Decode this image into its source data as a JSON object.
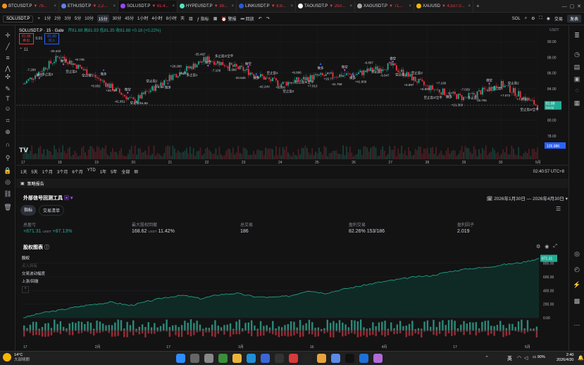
{
  "tabs": [
    {
      "symbol": "BTCUSDT.P",
      "change": "▼ 79...",
      "color": "#f7931a"
    },
    {
      "symbol": "ETHUSDT.P",
      "change": "▼ 2,2...",
      "color": "#627eea"
    },
    {
      "symbol": "SOLUSDT.P",
      "change": "▼ 81.4...",
      "color": "#9945ff"
    },
    {
      "symbol": "HYPEUSDT.P",
      "change": "▼ 39...",
      "color": "#50e3c2"
    },
    {
      "symbol": "LINKUSDT.P",
      "change": "▼ 8.9...",
      "color": "#2a5ada"
    },
    {
      "symbol": "TAOUSDT.P",
      "change": "▼ 250...",
      "color": "#ffffff"
    },
    {
      "symbol": "XAGUSDT.P",
      "change": "▼ 71...",
      "color": "#aaaaaa"
    },
    {
      "symbol": "XAUUSD",
      "change": "▼ 4,527.0...",
      "color": "#f5b800"
    }
  ],
  "toolbar": {
    "symbol": "SOLUSDT.P",
    "intervals": [
      "1分",
      "2分",
      "3分",
      "5分",
      "10分",
      "15分",
      "30分",
      "45分",
      "1小时",
      "4小时",
      "8小时",
      "天"
    ],
    "selected_interval": "15分",
    "indicators": "指标",
    "alert": "警报",
    "replay": "回放",
    "sol_label": "SOL",
    "trade": "交易",
    "publish": "发表"
  },
  "legend": {
    "title": "SOLUSDT.P · 15 · Gate",
    "ohlc": "开81.69 高81.93 低81.35 收81.88 +0.18 (+0.22%)",
    "sell_price": "81.88",
    "sell_label": "卖出",
    "spread": "0.01",
    "buy_price": "81.89",
    "buy_label": "买入",
    "indicator_count": "11"
  },
  "price_axis": {
    "currency": "USDT",
    "ticks": [
      "90.00",
      "88.00",
      "86.00",
      "84.00",
      "82.00",
      "80.00",
      "78.00"
    ],
    "last_price": "81.88",
    "countdown": "04:02",
    "equity_tag": "126.98K"
  },
  "chart_data": {
    "type": "line",
    "x": [
      "17",
      "18",
      "19",
      "20",
      "21",
      "22",
      "23",
      "24",
      "25",
      "26",
      "27",
      "28",
      "29",
      "30",
      "5月"
    ],
    "values": [
      84.6,
      88.2,
      85.4,
      82.4,
      85.5,
      87.8,
      86.4,
      84.6,
      85.6,
      85.8,
      87.0,
      84.2,
      82.8,
      84.6,
      81.88
    ],
    "ylim": [
      77,
      91
    ]
  },
  "trade_labels": [
    {
      "text": "-7.268",
      "kind": "value"
    },
    {
      "text": "做空",
      "kind": "short"
    },
    {
      "text": "多止盈2",
      "kind": "take"
    },
    {
      "text": "-20.442",
      "kind": "value"
    },
    {
      "text": "做空",
      "kind": "short"
    },
    {
      "text": "空止盈2",
      "kind": "take"
    },
    {
      "text": "+6.745",
      "kind": "value"
    },
    {
      "text": "空止盈1",
      "kind": "take"
    },
    {
      "text": "+6.952",
      "kind": "value"
    },
    {
      "text": "做多",
      "kind": "long"
    },
    {
      "text": "+20.797",
      "kind": "value"
    },
    {
      "text": "-41.951",
      "kind": "value"
    },
    {
      "text": "做空",
      "kind": "short"
    },
    {
      "text": "空止盈1",
      "kind": "take"
    },
    {
      "text": "+6.98",
      "kind": "value"
    },
    {
      "text": "空止盈2",
      "kind": "take"
    },
    {
      "text": "+6.98",
      "kind": "value"
    },
    {
      "text": "做多",
      "kind": "long"
    },
    {
      "text": "+28.288",
      "kind": "value"
    },
    {
      "text": "-6.961",
      "kind": "value"
    },
    {
      "text": "多止盈1",
      "kind": "take"
    },
    {
      "text": "-35.497",
      "kind": "value"
    },
    {
      "text": "做空",
      "kind": "short"
    },
    {
      "text": "-7.109",
      "kind": "value"
    },
    {
      "text": "多止盈2/全平",
      "kind": "take"
    },
    {
      "text": "-6.996",
      "kind": "value"
    },
    {
      "text": "-20.625",
      "kind": "value"
    },
    {
      "text": "做空",
      "kind": "short"
    },
    {
      "text": "做多",
      "kind": "long"
    },
    {
      "text": "-42.24V",
      "kind": "value"
    },
    {
      "text": "空止盈1",
      "kind": "take"
    },
    {
      "text": "+6.806",
      "kind": "value"
    },
    {
      "text": "空止盈2",
      "kind": "take"
    },
    {
      "text": "+6.806",
      "kind": "value"
    },
    {
      "text": "空止盈3/全平",
      "kind": "take"
    },
    {
      "text": "+7.013",
      "kind": "value"
    },
    {
      "text": "做多",
      "kind": "long"
    },
    {
      "text": "+20.77",
      "kind": "value"
    },
    {
      "text": "-41.768",
      "kind": "value"
    },
    {
      "text": "做空",
      "kind": "short"
    },
    {
      "text": "做多",
      "kind": "long"
    },
    {
      "text": "+41.809",
      "kind": "value"
    },
    {
      "text": "-6.867",
      "kind": "value"
    },
    {
      "text": "多止盈1",
      "kind": "take"
    },
    {
      "text": "-6.847",
      "kind": "value"
    },
    {
      "text": "做空",
      "kind": "short"
    },
    {
      "text": "空止盈1",
      "kind": "take"
    },
    {
      "text": "+6.897",
      "kind": "value"
    },
    {
      "text": "空止盈2",
      "kind": "take"
    },
    {
      "text": "+6.897",
      "kind": "value"
    },
    {
      "text": "空止盈3/全平",
      "kind": "take"
    },
    {
      "text": "+7.109",
      "kind": "value"
    },
    {
      "text": "做多",
      "kind": "long"
    },
    {
      "text": "+21.303",
      "kind": "value"
    },
    {
      "text": "-7.029",
      "kind": "value"
    },
    {
      "text": "多止盈1",
      "kind": "take"
    },
    {
      "text": "-15.705",
      "kind": "value"
    },
    {
      "text": "做空",
      "kind": "short"
    },
    {
      "text": "空止盈1",
      "kind": "take"
    },
    {
      "text": "+7.072",
      "kind": "value"
    },
    {
      "text": "空止盈2",
      "kind": "take"
    },
    {
      "text": "+7.072",
      "kind": "value"
    },
    {
      "text": "空止盈3/全平",
      "kind": "take"
    }
  ],
  "timebar": {
    "ranges": [
      "1天",
      "5天",
      "1个月",
      "3个月",
      "6个月",
      "YTD",
      "1年",
      "5年",
      "全部"
    ],
    "clock": "02:40:57 UTC+8"
  },
  "panel": {
    "tab_label": "策略报告",
    "tool_name": "外部信号回测工具",
    "date_range": "2026年1月30日 — 2026年4月30日",
    "tabs": [
      "指标",
      "交易清单"
    ],
    "metrics": [
      {
        "label": "总盈亏",
        "value": "+871.31",
        "unit": "USDT",
        "extra": "+87.13%"
      },
      {
        "label": "最大股权回撤",
        "value": "168.62",
        "unit": "USDT",
        "extra": "11.42%"
      },
      {
        "label": "总交易",
        "value": "186",
        "unit": "",
        "extra": ""
      },
      {
        "label": "盈利交易",
        "value": "82.26%",
        "unit": "",
        "extra": "153/186"
      },
      {
        "label": "盈利因子",
        "value": "2.019",
        "unit": "",
        "extra": ""
      }
    ],
    "equity_title": "股权图表",
    "legend": [
      "股权",
      "买入持有",
      "交易波动幅度",
      "上涨/回撤"
    ],
    "equity_axis": [
      "800.00",
      "600.00",
      "400.00",
      "200.00",
      "0.00"
    ],
    "equity_last": "871.31",
    "x_labels": [
      "17",
      "2月",
      "17",
      "3月",
      "16",
      "4月",
      "17",
      "5月"
    ]
  },
  "equity_data": {
    "type": "area",
    "values": [
      0,
      70,
      110,
      160,
      200,
      230,
      180,
      240,
      300,
      330,
      280,
      340,
      360,
      310,
      300,
      320,
      400,
      360,
      420,
      470,
      520,
      560,
      600,
      620,
      680,
      720,
      740,
      780,
      810,
      871.31
    ],
    "ylim": [
      0,
      900
    ]
  },
  "taskbar": {
    "weather_temp": "14°C",
    "weather_desc": "大部晴朗",
    "lang": "英",
    "battery": "90%",
    "time": "2:40",
    "date": "2026/4/30"
  }
}
